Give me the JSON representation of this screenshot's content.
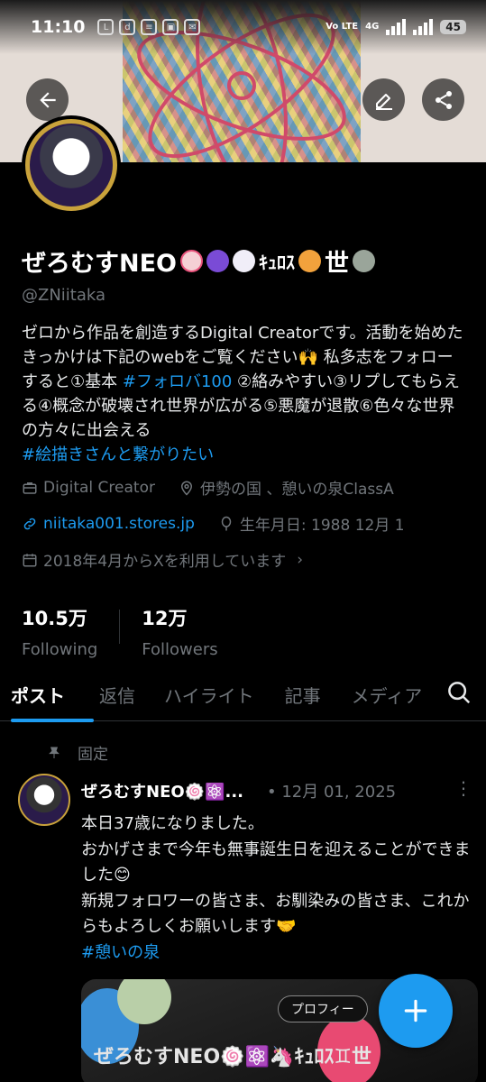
{
  "status_bar": {
    "time": "11:10",
    "icons": [
      "line-icon",
      "dmenu-icon",
      "news-icon",
      "gallery-icon",
      "mail-icon"
    ],
    "network": "Vo LTE",
    "signal": "4G",
    "battery": "45"
  },
  "profile": {
    "display_name": "ぜろむすNEO",
    "name_emoji_text": "ｷｭﾛｽ",
    "name_suffix": "世",
    "handle": "@ZNiitaka",
    "bio_text": "ゼロから作品を創造するDigital Creatorです。活動を始めたきっかけは下記のwebをご覧ください🙌 私多志をフォローすると①基本 ",
    "bio_link1": "#フォロバ100",
    "bio_text2": " ②絡みやすい③リプしてもらえる④概念が破壊され世界が広がる⑤悪魔が退散⑥色々な世界の方々に出会える",
    "bio_link2": "#絵描きさんと繋がりたい",
    "category": "Digital Creator",
    "location": "伊勢の国 、憩いの泉ClassA",
    "website": "niitaka001.stores.jp",
    "birthday": "生年月日: 1988 12月 1",
    "joined": "2018年4月からXを利用しています"
  },
  "stats": {
    "following_count": "10.5万",
    "following_label": "Following",
    "followers_count": "12万",
    "followers_label": "Followers"
  },
  "tabs": [
    "ポスト",
    "返信",
    "ハイライト",
    "記事",
    "メディア"
  ],
  "pinned_label": "固定",
  "post": {
    "author": "ぜろむすNEO🍥⚛️...",
    "date": "• 12月 01, 2025",
    "body_line1": "本日37歳になりました。",
    "body_line2": "おかげさまで今年も無事誕生日を迎えることができました😊",
    "body_line3": "新規フォロワーの皆さま、お馴染みの皆さま、これからもよろしくお願いします🤝",
    "hashtag": "#憩いの泉",
    "media_chip": "プロフィー",
    "media_caption": "ぜろむすNEO🍥⚛️🦄ｷｭﾛｽ♊世"
  },
  "colors": {
    "accent": "#1d9bf0",
    "muted": "#71767b",
    "background": "#000000"
  }
}
